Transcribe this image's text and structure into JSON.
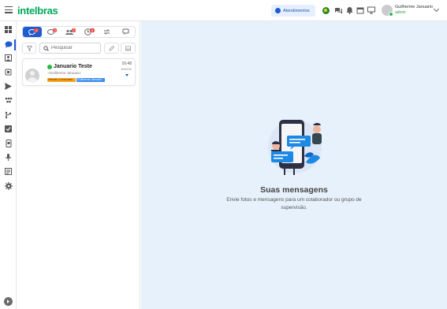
{
  "header": {
    "logo": "intelbras",
    "atendimentos_label": "Atendimentos",
    "user_name": "Guilherme Januario",
    "user_role": "admin"
  },
  "conversation_tabs": [
    {
      "icon": "chat-icon",
      "badge": "1"
    },
    {
      "icon": "chat-outline-icon",
      "badge": "0"
    },
    {
      "icon": "group-icon",
      "badge": "0"
    },
    {
      "icon": "clock-chat-icon",
      "badge": "0"
    },
    {
      "icon": "refresh-chat-icon",
      "badge": ""
    },
    {
      "icon": "comments-icon",
      "badge": ""
    }
  ],
  "search": {
    "placeholder": "Pesquisar"
  },
  "chat": {
    "name": "Januario Teste",
    "subtitle": "~Guilherme Januario:",
    "time": "16:48",
    "date": "8/30/90",
    "tags": [
      "Vendas Comerciais",
      "Guilherme Januario"
    ]
  },
  "empty_state": {
    "title": "Suas mensagens",
    "description": "Envie fotos e mensagens para um colaborador ou grupo de supervisão."
  },
  "colors": {
    "primary": "#1e5bd0",
    "brand_green": "#00a859",
    "main_background": "#e7f1fb",
    "badge_red": "#e84a4a"
  }
}
